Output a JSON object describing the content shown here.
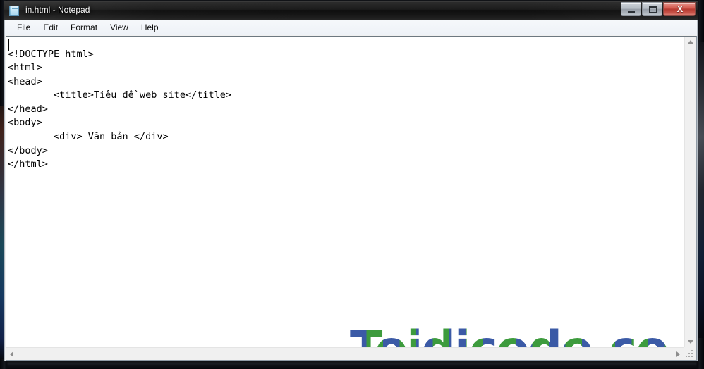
{
  "window": {
    "title": "in.html - Notepad",
    "icon": "notepad-icon",
    "controls": {
      "minimize": "minimize-button",
      "maximize": "maximize-button",
      "close_label": "X"
    }
  },
  "menubar": {
    "items": [
      {
        "label": "File"
      },
      {
        "label": "Edit"
      },
      {
        "label": "Format"
      },
      {
        "label": "View"
      },
      {
        "label": "Help"
      }
    ]
  },
  "editor": {
    "content": "<!DOCTYPE html>\n<html>\n<head>\n        <title>Tiêu đề web site</title>\n</head>\n<body>\n        <div> Văn bản </div>\n</body>\n</html>",
    "lines": [
      "<!DOCTYPE html>",
      "<html>",
      "<head>",
      "        <title>Tiêu đề web site</title>",
      "</head>",
      "<body>",
      "        <div> Văn bản </div>",
      "</body>",
      "</html>"
    ],
    "caret_line": 1,
    "caret_column": 1
  },
  "watermark": {
    "text": "Toidicode.com",
    "color_left": "#3b5aa6",
    "color_right": "#3d9b3d"
  },
  "scrollbars": {
    "vertical": {
      "up_arrow": "scroll-up-arrow",
      "down_arrow": "scroll-down-arrow"
    },
    "horizontal": {
      "left_arrow": "scroll-left-arrow",
      "right_arrow": "scroll-right-arrow"
    },
    "resize_grip": "resize-grip"
  }
}
